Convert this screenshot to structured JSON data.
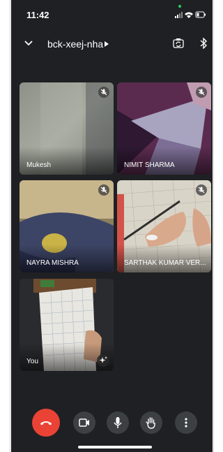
{
  "status_bar": {
    "time": "11:42"
  },
  "header": {
    "meeting_code": "bck-xeej-nha"
  },
  "participants": [
    {
      "name": "Mukesh",
      "muted": true
    },
    {
      "name": "NIMIT SHARMA",
      "muted": true
    },
    {
      "name": "NAYRA MISHRA",
      "muted": true
    },
    {
      "name": "SARTHAK KUMAR VER...",
      "muted": true
    },
    {
      "name": "You",
      "muted": false
    }
  ],
  "controls": [
    "end-call",
    "camera",
    "microphone",
    "raise-hand",
    "more-options"
  ],
  "colors": {
    "background": "#1f2023",
    "end_call": "#ea4335",
    "control": "#3c4043",
    "status_dot": "#29d15a"
  }
}
